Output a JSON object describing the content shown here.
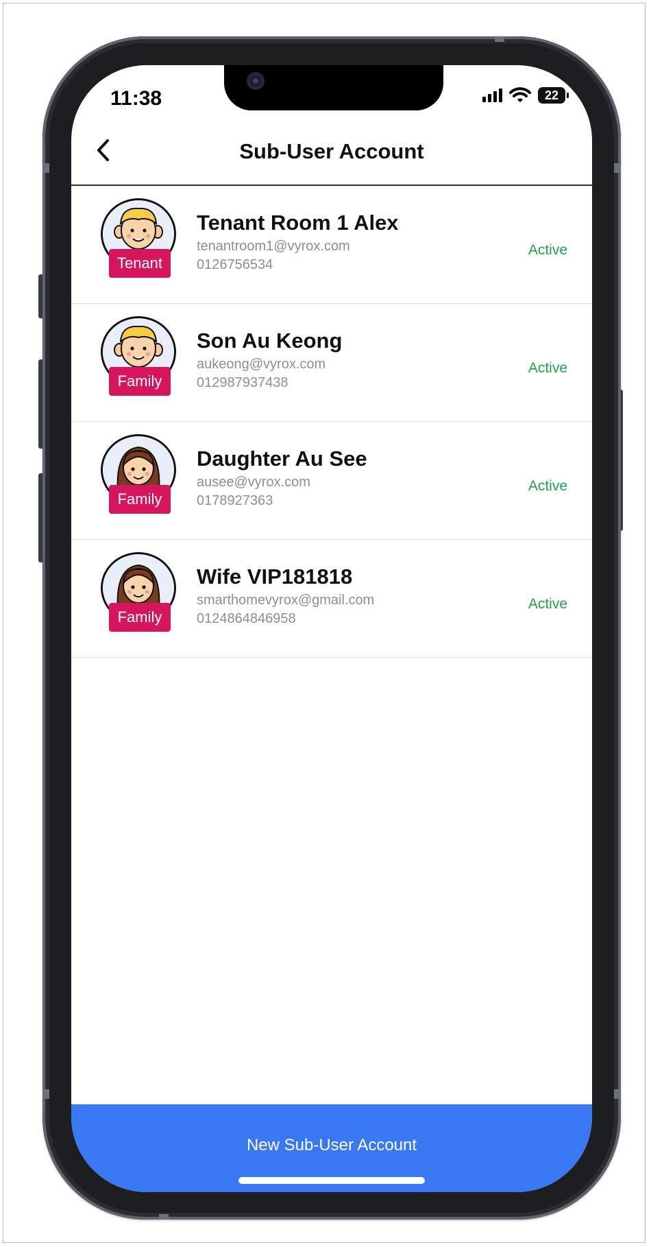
{
  "status_bar": {
    "time": "11:38",
    "battery": "22"
  },
  "header": {
    "title": "Sub-User Account",
    "back_icon": "chevron-left-icon"
  },
  "users": [
    {
      "name": "Tenant Room 1 Alex",
      "email": "tenantroom1@vyrox.com",
      "phone": "0126756534",
      "role": "Tenant",
      "status": "Active",
      "avatar": "boy-avatar"
    },
    {
      "name": "Son Au Keong",
      "email": "aukeong@vyrox.com",
      "phone": "012987937438",
      "role": "Family",
      "status": "Active",
      "avatar": "boy-avatar"
    },
    {
      "name": "Daughter Au See",
      "email": "ausee@vyrox.com",
      "phone": "0178927363",
      "role": "Family",
      "status": "Active",
      "avatar": "girl-avatar"
    },
    {
      "name": "Wife VIP181818",
      "email": "smarthomevyrox@gmail.com",
      "phone": "0124864846958",
      "role": "Family",
      "status": "Active",
      "avatar": "girl-avatar"
    }
  ],
  "footer": {
    "new_button_label": "New Sub-User Account"
  },
  "colors": {
    "accent": "#3a78f2",
    "badge": "#d6155d",
    "active": "#1fa34a"
  }
}
